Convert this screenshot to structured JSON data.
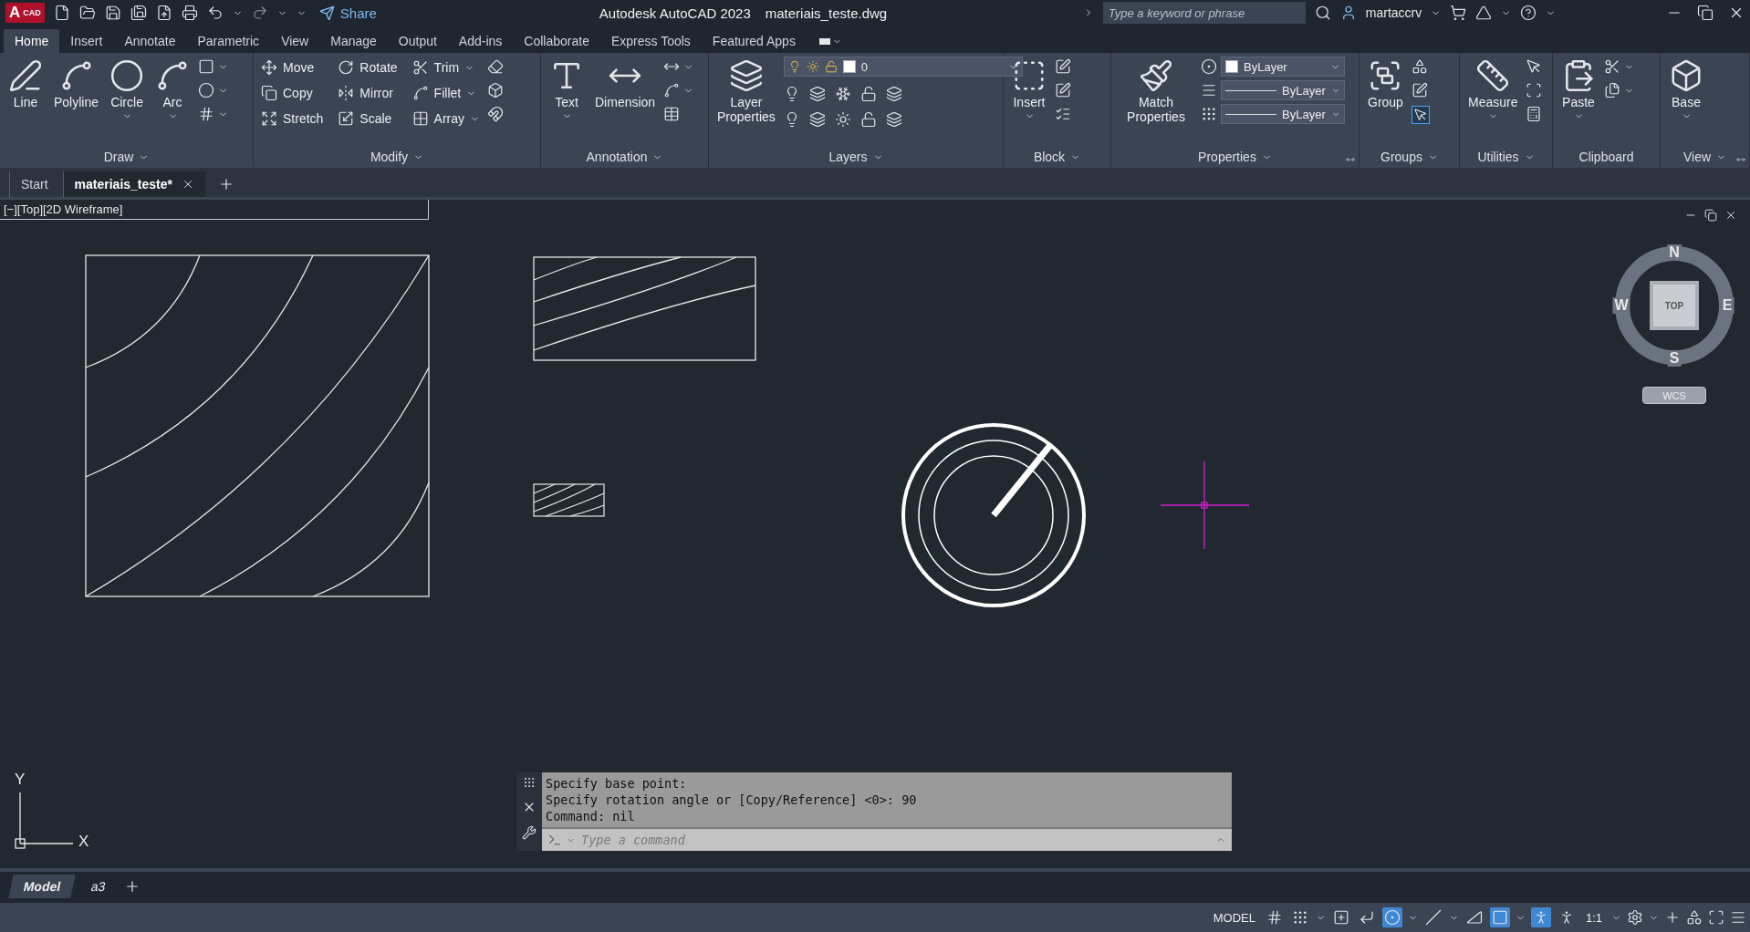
{
  "title_bar": {
    "logo": {
      "letter": "A",
      "text": "CAD"
    },
    "share": "Share",
    "app_title": "Autodesk AutoCAD 2023",
    "file_name": "materiais_teste.dwg",
    "search": {
      "placeholder": "Type a keyword or phrase"
    },
    "user": "martaccrv"
  },
  "ribbon_tabs": [
    {
      "label": "Home",
      "selected": true
    },
    {
      "label": "Insert",
      "selected": false
    },
    {
      "label": "Annotate",
      "selected": false
    },
    {
      "label": "Parametric",
      "selected": false
    },
    {
      "label": "View",
      "selected": false
    },
    {
      "label": "Manage",
      "selected": false
    },
    {
      "label": "Output",
      "selected": false
    },
    {
      "label": "Add-ins",
      "selected": false
    },
    {
      "label": "Collaborate",
      "selected": false
    },
    {
      "label": "Express Tools",
      "selected": false
    },
    {
      "label": "Featured Apps",
      "selected": false
    }
  ],
  "ribbon_panels": [
    {
      "title": "Draw",
      "menu": true,
      "large": [
        {
          "label": "Line",
          "dropdown": false
        },
        {
          "label": "Polyline",
          "dropdown": false
        },
        {
          "label": "Circle",
          "dropdown": true
        },
        {
          "label": "Arc",
          "dropdown": true
        }
      ]
    },
    {
      "title": "Modify",
      "menu": true,
      "small": [
        {
          "label": "Move",
          "dropdown": false
        },
        {
          "label": "Rotate",
          "dropdown": false
        },
        {
          "label": "Trim",
          "dropdown": true
        },
        {
          "label": "Copy",
          "dropdown": false
        },
        {
          "label": "Mirror",
          "dropdown": false
        },
        {
          "label": "Fillet",
          "dropdown": true
        },
        {
          "label": "Stretch",
          "dropdown": false
        },
        {
          "label": "Scale",
          "dropdown": false
        },
        {
          "label": "Array",
          "dropdown": true
        }
      ]
    },
    {
      "title": "Annotation",
      "menu": true,
      "large": [
        {
          "label": "Text",
          "dropdown": true
        },
        {
          "label": "Dimension",
          "dropdown": false
        }
      ]
    },
    {
      "title": "Layers",
      "menu": true,
      "large": [
        {
          "label": "Layer Properties",
          "dropdown": false
        }
      ],
      "layer_select": "0"
    },
    {
      "title": "Block",
      "menu": true,
      "large": [
        {
          "label": "Insert",
          "dropdown": true
        }
      ]
    },
    {
      "title": "Properties",
      "menu": true,
      "large": [
        {
          "label": "Match Properties",
          "dropdown": false
        }
      ],
      "selects": [
        "ByLayer",
        "ByLayer",
        "ByLayer"
      ]
    },
    {
      "title": "Groups",
      "menu": true,
      "large": [
        {
          "label": "Group",
          "dropdown": false
        }
      ],
      "selection_on": true
    },
    {
      "title": "Utilities",
      "menu": true,
      "large": [
        {
          "label": "Measure",
          "dropdown": true
        }
      ]
    },
    {
      "title": "Clipboard",
      "menu": false,
      "large": [
        {
          "label": "Paste",
          "dropdown": true
        }
      ]
    },
    {
      "title": "View",
      "menu": true,
      "large": [
        {
          "label": "Base",
          "dropdown": true
        }
      ]
    }
  ],
  "file_tabs": [
    {
      "label": "Start",
      "selected": false
    },
    {
      "label": "materiais_teste*",
      "selected": true
    }
  ],
  "viewport": {
    "label": "[−][Top][2D Wireframe]"
  },
  "view_cube": {
    "north": "N",
    "south": "S",
    "east": "E",
    "west": "W",
    "face": "TOP",
    "ucs": "WCS"
  },
  "ucs_icon": {
    "y": "Y",
    "x": "X"
  },
  "command_line": {
    "history": [
      "Specify base point:",
      "Specify rotation angle or [Copy/Reference] <0>: 90",
      "Command: nil"
    ],
    "placeholder": "Type a command"
  },
  "layout_tabs": [
    {
      "label": "Model",
      "selected": true
    },
    {
      "label": "a3",
      "selected": false
    }
  ],
  "status_bar": {
    "mode": "MODEL",
    "scale": "1:1",
    "toggles": [
      {
        "on": false
      },
      {
        "on": false
      },
      {
        "on": false
      },
      {
        "on": false
      },
      {
        "on": true
      },
      {
        "on": false
      },
      {
        "on": false
      },
      {
        "on": true
      },
      {
        "on": true
      },
      {
        "on": false
      }
    ]
  }
}
